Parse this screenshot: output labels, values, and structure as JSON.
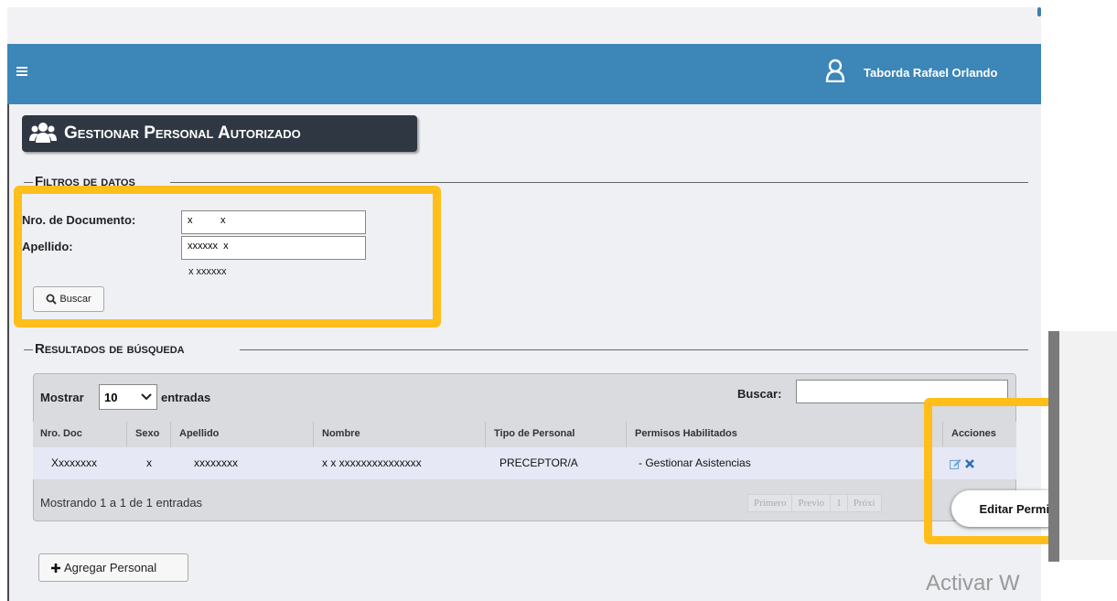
{
  "header": {
    "menu_icon": "hamburger-icon",
    "user_icon": "user-icon",
    "user_name": "Taborda Rafael Orlando",
    "bar_color": "#3c86b8"
  },
  "page": {
    "title_icon": "users-icon",
    "title": "Gestionar Personal Autorizado"
  },
  "filters": {
    "legend": "Filtros de datos",
    "documento_label": "Nro. de Documento:",
    "documento_value": "x          x",
    "apellido_label": "Apellido:",
    "apellido_value": "xxxxxx  x",
    "hint": "x xxxxxx",
    "buscar_button": "Buscar",
    "buscar_icon": "search-icon"
  },
  "results": {
    "legend": "Resultados de búsqueda",
    "mostrar_label": "Mostrar",
    "page_size": "10",
    "entradas_label": "entradas",
    "buscar_label": "Buscar:",
    "columns": [
      "Nro. Doc",
      "Sexo",
      "Apellido",
      "Nombre",
      "Tipo de Personal",
      "Permisos Habilitados",
      "Acciones"
    ],
    "rows": [
      {
        "nro_doc": "Xxxxxxxx",
        "sexo": "x",
        "apellido": "xxxxxxxx",
        "nombre": "x x xxxxxxxxxxxxxxx",
        "tipo": "PRECEPTOR/A",
        "permisos": "- Gestionar Asistencias",
        "actions": [
          "edit-icon",
          "delete-icon"
        ]
      }
    ],
    "info": "Mostrando 1 a 1 de 1 entradas",
    "pagination": [
      "Primero",
      "Previo",
      "1",
      "Próxi"
    ]
  },
  "tooltip": "Editar Permisos",
  "add_button": "Agregar Personal",
  "add_icon": "plus-icon",
  "watermark": "Activar W",
  "accent_highlight": "#ffbe1a"
}
